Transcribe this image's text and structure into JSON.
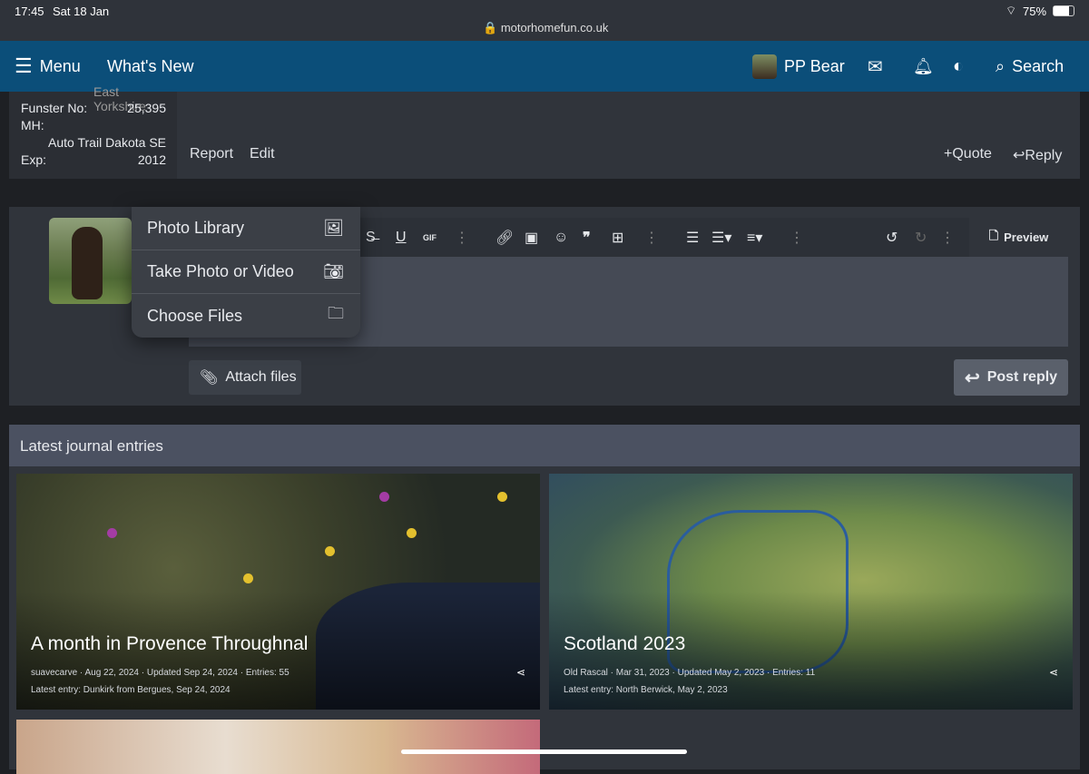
{
  "status_bar": {
    "time": "17:45",
    "date": "Sat 18 Jan",
    "url": "motorhomefun.co.uk",
    "battery": "75%",
    "battery_level": 0.75
  },
  "header": {
    "menu": "Menu",
    "whats_new": "What's New",
    "user": "PP Bear",
    "search": "Search"
  },
  "post": {
    "location_partial": "East Yorkshire",
    "fields": [
      {
        "label": "Funster No:",
        "value": "25,395"
      },
      {
        "label": "MH:",
        "value": ""
      },
      {
        "label": "",
        "value": "Auto Trail Dakota SE"
      },
      {
        "label": "Exp:",
        "value": "2012"
      }
    ],
    "actions": {
      "report": "Report",
      "edit": "Edit",
      "quote": "+Quote",
      "reply": "Reply"
    }
  },
  "editor": {
    "popup": [
      {
        "label": "Photo Library",
        "icon": "photo-library-icon"
      },
      {
        "label": "Take Photo or Video",
        "icon": "camera-icon"
      },
      {
        "label": "Choose Files",
        "icon": "folder-icon"
      }
    ],
    "gif": "GIF",
    "preview": "Preview",
    "attach": "Attach files",
    "post_reply": "Post reply"
  },
  "journals": {
    "heading": "Latest journal entries",
    "cards": [
      {
        "title": "A month in Provence Throughnal",
        "meta": "suavecarve · Aug 22, 2024 · Updated Sep 24, 2024 · Entries: 55",
        "latest": "Latest entry: Dunkirk from Bergues, Sep 24, 2024"
      },
      {
        "title": "Scotland 2023",
        "meta": "Old Rascal · Mar 31, 2023 · Updated May 2, 2023 · Entries: 11",
        "latest": "Latest entry: North Berwick, May 2, 2023"
      }
    ]
  },
  "colors": {
    "header": "#0b4e79",
    "panel": "#30343b",
    "journal_header": "#4b5161"
  }
}
